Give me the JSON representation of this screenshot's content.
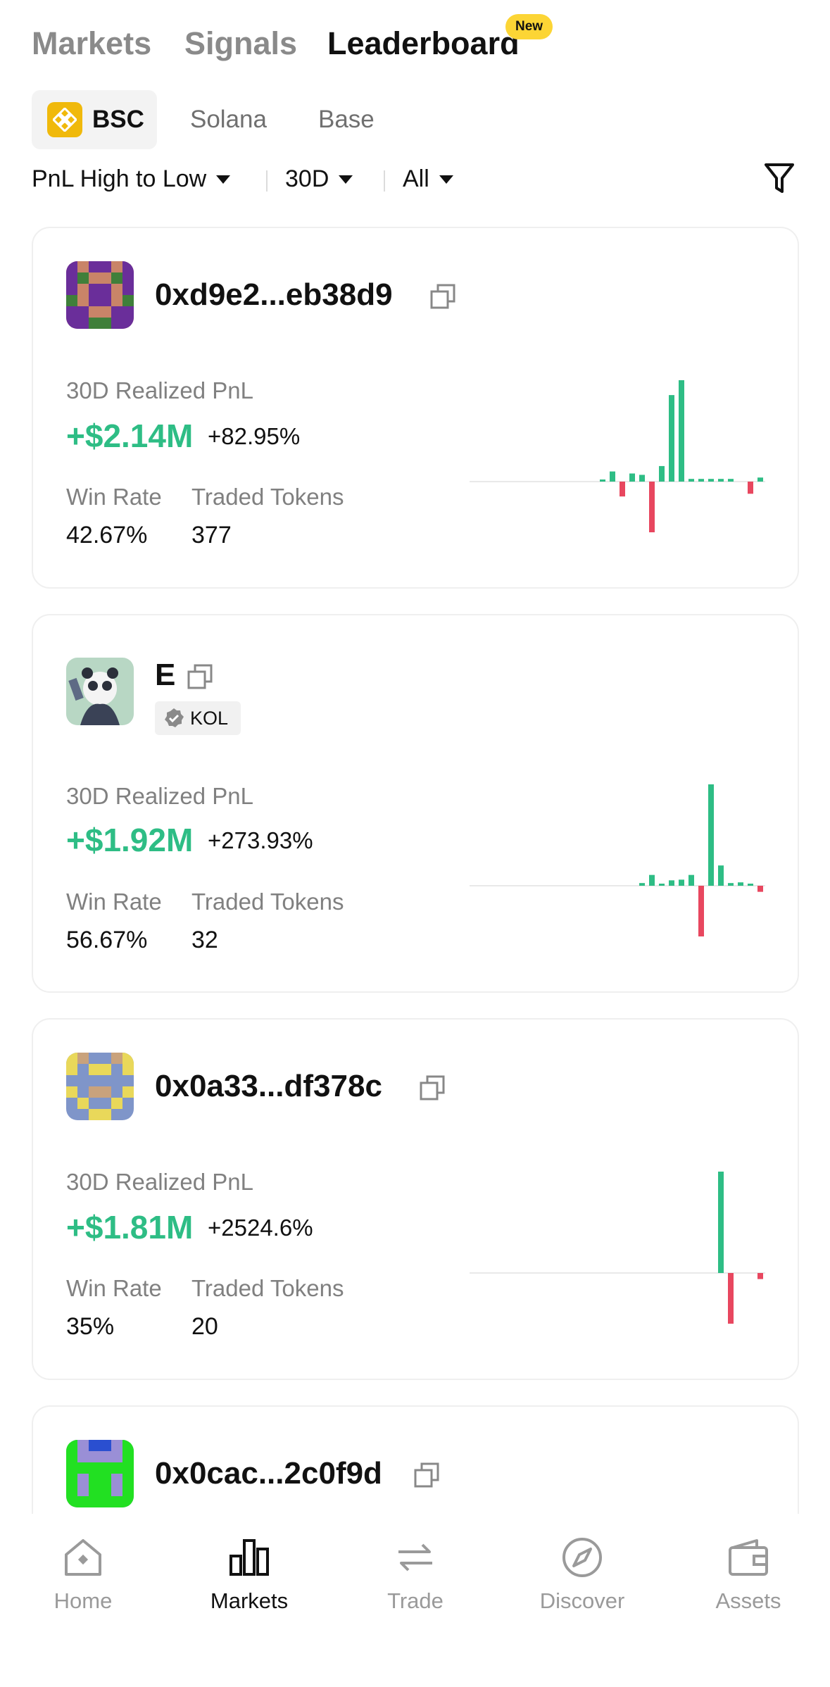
{
  "top_tabs": [
    {
      "label": "Markets"
    },
    {
      "label": "Signals"
    },
    {
      "label": "Leaderboard",
      "badge": "New"
    }
  ],
  "chains": [
    {
      "label": "BSC",
      "active": true,
      "icon": "bsc-logo-icon"
    },
    {
      "label": "Solana"
    },
    {
      "label": "Base"
    }
  ],
  "filters": {
    "sort": "PnL High to Low",
    "period": "30D",
    "scope": "All",
    "filter_icon": "funnel-icon"
  },
  "labels": {
    "pnl_label": "30D Realized PnL",
    "win_rate": "Win Rate",
    "traded_tokens": "Traded Tokens"
  },
  "cards": [
    {
      "address": "0xd9e2...eb38d9",
      "pnl": "+$2.14M",
      "pnl_pct": "+82.95%",
      "win_rate": "42.67%",
      "traded_tokens": "377",
      "sparkline": [
        0,
        0,
        0,
        0,
        0,
        0,
        0,
        0,
        0,
        0,
        0,
        0,
        0,
        0.3,
        1.5,
        -2.2,
        1.2,
        1.0,
        -7.5,
        2.3,
        12.8,
        15.0,
        0.4,
        0.4,
        0.4,
        0.4,
        0.4,
        0,
        -1.8,
        0.6
      ]
    },
    {
      "address": "E",
      "badge": "KOL",
      "pnl": "+$1.92M",
      "pnl_pct": "+273.93%",
      "win_rate": "56.67%",
      "traded_tokens": "32",
      "sparkline": [
        0,
        0,
        0,
        0,
        0,
        0,
        0,
        0,
        0,
        0,
        0,
        0,
        0,
        0,
        0,
        0,
        0,
        0.4,
        1.6,
        0.3,
        0.8,
        0.9,
        1.6,
        -7.5,
        15.0,
        3.0,
        0.4,
        0.5,
        0.2,
        -0.9
      ]
    },
    {
      "address": "0x0a33...df378c",
      "pnl": "+$1.81M",
      "pnl_pct": "+2524.6%",
      "win_rate": "35%",
      "traded_tokens": "20",
      "sparkline": [
        0,
        0,
        0,
        0,
        0,
        0,
        0,
        0,
        0,
        0,
        0,
        0,
        0,
        0,
        0,
        0,
        0,
        0,
        0,
        0,
        0,
        0,
        0,
        0,
        0,
        15.0,
        -7.5,
        0,
        0,
        -0.9
      ]
    },
    {
      "address": "0x0cac...2c0f9d"
    }
  ],
  "bottom_nav": [
    {
      "label": "Home",
      "icon": "home-icon"
    },
    {
      "label": "Markets",
      "icon": "markets-icon",
      "active": true
    },
    {
      "label": "Trade",
      "icon": "trade-icon"
    },
    {
      "label": "Discover",
      "icon": "discover-icon"
    },
    {
      "label": "Assets",
      "icon": "assets-icon"
    }
  ],
  "colors": {
    "positive": "#2EBD85",
    "negative": "#E8475F",
    "accent": "#FCD535",
    "bsc": "#F0B90B"
  }
}
